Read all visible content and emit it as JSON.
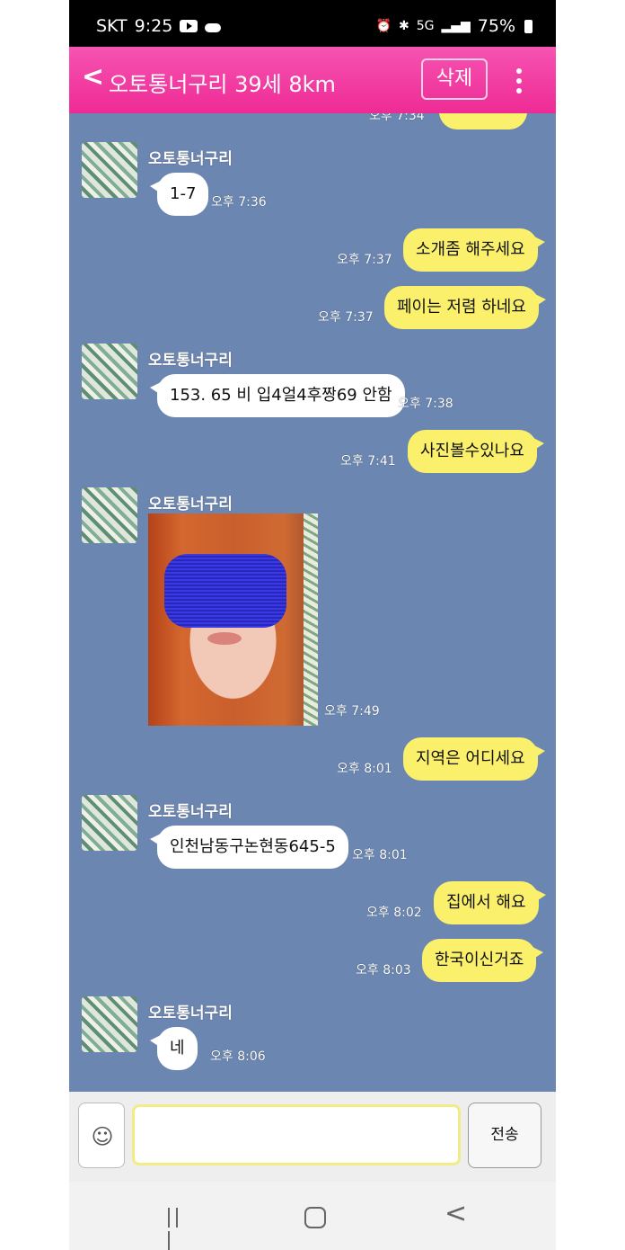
{
  "status_bar": {
    "carrier": "SKT",
    "time": "9:25",
    "network": "5G",
    "battery": "75%"
  },
  "header": {
    "title": "오토통너구리 39세 8km",
    "delete_label": "삭제"
  },
  "chat": {
    "partial_top_time": "오후 7:34",
    "sender_name": "오토통너구리",
    "messages": [
      {
        "side": "in",
        "text": "1-7",
        "time": "오후 7:36"
      },
      {
        "side": "out",
        "text": "소개좀 해주세요",
        "time": "오후 7:37"
      },
      {
        "side": "out",
        "text": "페이는 저렴 하네요",
        "time": "오후 7:37"
      },
      {
        "side": "in",
        "text": "153. 65 비 입4얼4후짱69 안함",
        "time": "오후 7:38"
      },
      {
        "side": "out",
        "text": "사진볼수있나요",
        "time": "오후 7:41"
      },
      {
        "side": "in",
        "type": "photo",
        "time": "오후 7:49"
      },
      {
        "side": "out",
        "text": "지역은 어디세요",
        "time": "오후 8:01"
      },
      {
        "side": "in",
        "text": "인천남동구논현동645-5",
        "time": "오후 8:01"
      },
      {
        "side": "out",
        "text": "집에서 해요",
        "time": "오후 8:02"
      },
      {
        "side": "out",
        "text": "한국이신거죠",
        "time": "오후 8:03"
      },
      {
        "side": "in",
        "text": "네",
        "time": "오후 8:06"
      }
    ]
  },
  "input_bar": {
    "send_label": "전송",
    "message_value": ""
  },
  "colors": {
    "header": "#ee2b94",
    "chat_bg": "#6b86b1",
    "out_bubble": "#fbf06b",
    "in_bubble": "#ffffff"
  }
}
